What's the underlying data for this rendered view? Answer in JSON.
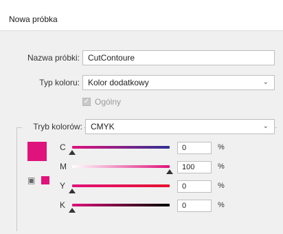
{
  "dialog": {
    "title": "Nowa próbka"
  },
  "form": {
    "swatch_name_label": "Nazwa próbki:",
    "swatch_name_value": "CutContoure",
    "color_type_label": "Typ koloru:",
    "color_type_value": "Kolor dodatkowy",
    "global_label": "Ogólny",
    "global_checked": true,
    "color_mode_label": "Tryb kolorów:",
    "color_mode_value": "CMYK"
  },
  "swatch_color": "#e0127b",
  "icons": {
    "dropdown": "chevron-down-icon",
    "out_of_gamut": "cube-icon",
    "checkbox": "checkmark-icon"
  },
  "channels": [
    {
      "label": "C",
      "value": "0",
      "unit": "%",
      "fraction": 0.0,
      "gradient": [
        "#e0127b",
        "#2e3192"
      ]
    },
    {
      "label": "M",
      "value": "100",
      "unit": "%",
      "fraction": 1.0,
      "gradient": [
        "#ffffff",
        "#e0127b"
      ]
    },
    {
      "label": "Y",
      "value": "0",
      "unit": "%",
      "fraction": 0.0,
      "gradient": [
        "#e0127b",
        "#e8112d"
      ]
    },
    {
      "label": "K",
      "value": "0",
      "unit": "%",
      "fraction": 0.0,
      "gradient": [
        "#e0127b",
        "#000000"
      ]
    }
  ]
}
